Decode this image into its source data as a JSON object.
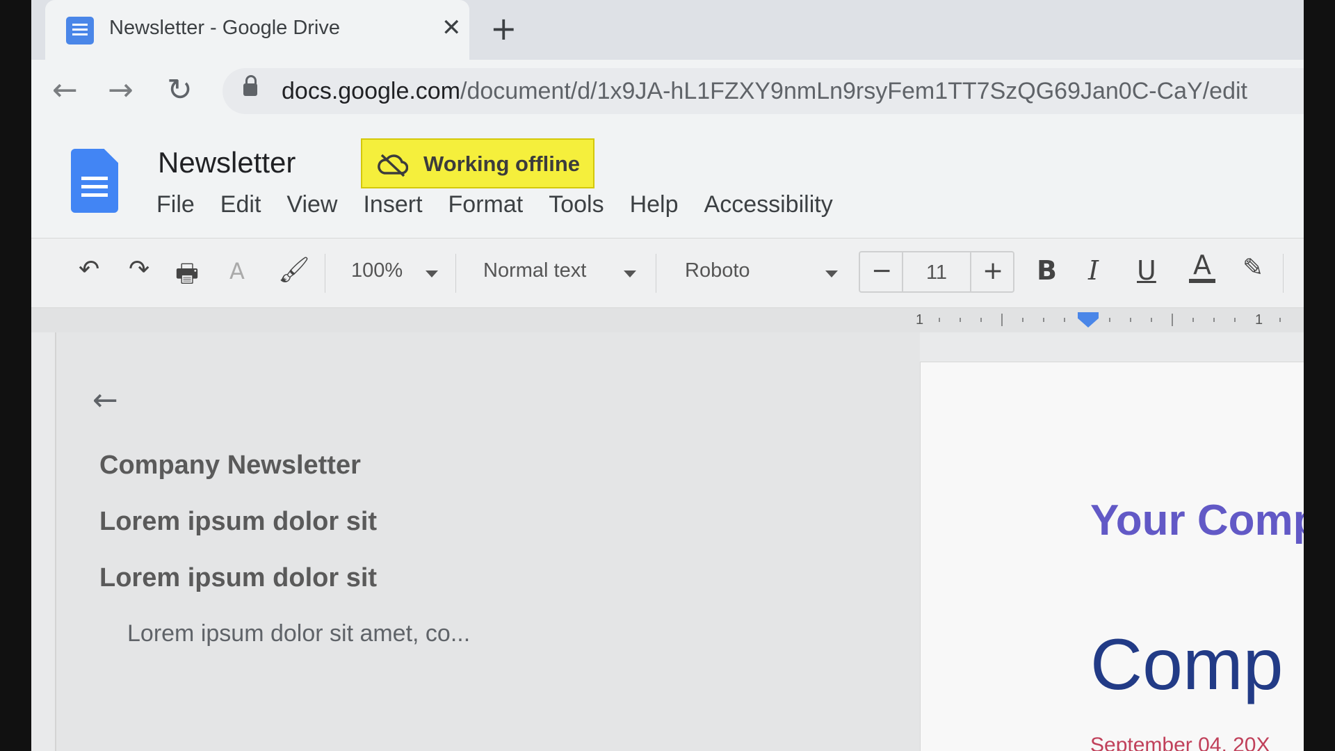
{
  "browser": {
    "tab_title": "Newsletter - Google Drive",
    "tab_close": "✕",
    "new_tab": "+",
    "url_host": "docs.google.com",
    "url_path": "/document/d/1x9JA-hL1FZXY9nmLn9rsyFem1TT7SzQG69Jan0C-CaY/edit",
    "back": "←",
    "forward": "→",
    "reload": "↻"
  },
  "docs": {
    "title": "Newsletter",
    "offline_label": "Working offline",
    "menu": [
      "File",
      "Edit",
      "View",
      "Insert",
      "Format",
      "Tools",
      "Help",
      "Accessibility"
    ]
  },
  "toolbar": {
    "undo": "↶",
    "redo": "↷",
    "print": "🖶",
    "spellcheck": "A",
    "paint_format": "🖌",
    "zoom": "100%",
    "style": "Normal text",
    "font": "Roboto",
    "font_size": "11",
    "decrease": "−",
    "increase": "+",
    "bold": "B",
    "italic": "I",
    "underline": "U",
    "text_color": "A",
    "highlight": "✎"
  },
  "ruler": {
    "left_num": "1",
    "right_num": "1"
  },
  "outline": {
    "back": "←",
    "headings": [
      "Company Newsletter",
      "Lorem ipsum dolor sit",
      "Lorem ipsum dolor sit"
    ],
    "sub": "Lorem ipsum dolor sit amet, co..."
  },
  "page": {
    "company": "Your Comp",
    "big": "Comp",
    "date": "September 04, 20X"
  },
  "colors": {
    "accent": "#4285f4",
    "offline_bg": "#f5ef3c",
    "heading_purple": "#6259c6",
    "heading_navy": "#223b86",
    "date_red": "#c0405a"
  }
}
